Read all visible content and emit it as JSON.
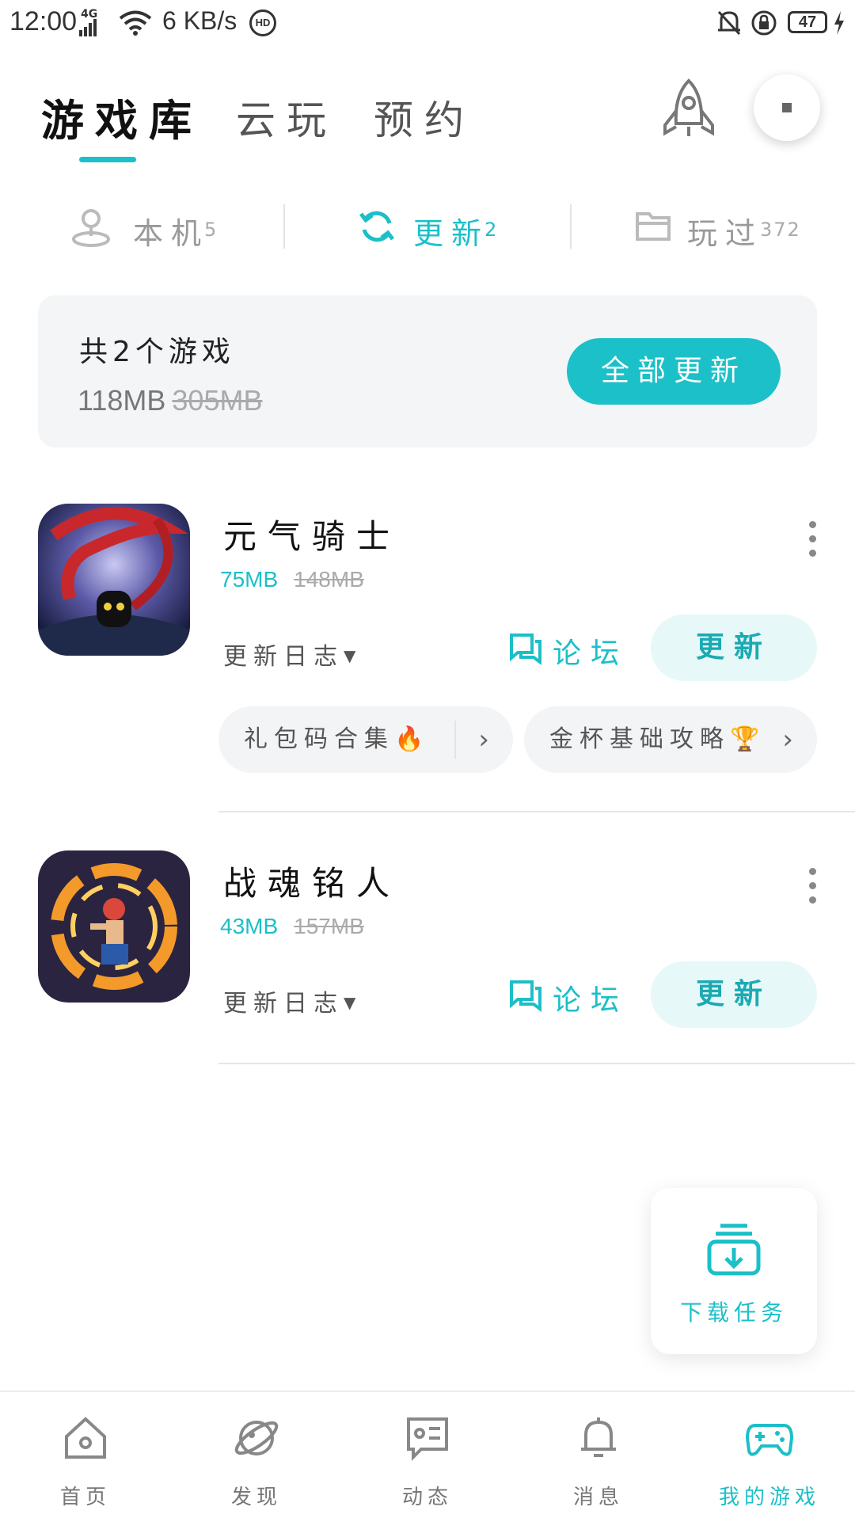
{
  "status_bar": {
    "time": "12:00",
    "network_type": "4G",
    "speed": "6 KB/s",
    "hd": "HD",
    "battery": "47"
  },
  "top_tabs": [
    {
      "label": "游戏库",
      "active": true
    },
    {
      "label": "云玩",
      "active": false
    },
    {
      "label": "预约",
      "active": false
    }
  ],
  "sub_tabs": [
    {
      "label": "本机",
      "count": "5",
      "active": false,
      "icon": "device-location-icon"
    },
    {
      "label": "更新",
      "count": "2",
      "active": true,
      "icon": "refresh-icon"
    },
    {
      "label": "玩过",
      "count": "372",
      "active": false,
      "icon": "folder-icon"
    }
  ],
  "summary": {
    "count_text": "共2个游戏",
    "size": "118MB",
    "original_size": "305MB",
    "update_all_label": "全部更新"
  },
  "games": [
    {
      "name": "元气骑士",
      "size": "75MB",
      "original_size": "148MB",
      "changelog_label": "更新日志",
      "forum_label": "论坛",
      "update_label": "更新",
      "pills": [
        {
          "label": "礼包码合集",
          "emoji": "🔥"
        },
        {
          "label": "金杯基础攻略",
          "emoji": "🏆"
        }
      ]
    },
    {
      "name": "战魂铭人",
      "size": "43MB",
      "original_size": "157MB",
      "changelog_label": "更新日志",
      "forum_label": "论坛",
      "update_label": "更新"
    }
  ],
  "download_task": {
    "label": "下载任务"
  },
  "bottom_nav": [
    {
      "label": "首页",
      "icon": "home-icon",
      "active": false
    },
    {
      "label": "发现",
      "icon": "planet-icon",
      "active": false
    },
    {
      "label": "动态",
      "icon": "feed-icon",
      "active": false
    },
    {
      "label": "消息",
      "icon": "bell-icon",
      "active": false
    },
    {
      "label": "我的游戏",
      "icon": "gamepad-icon",
      "active": true
    }
  ],
  "colors": {
    "accent": "#1cc0c8",
    "accent_light": "#e7f8f8",
    "card_bg": "#f3f5f7"
  }
}
